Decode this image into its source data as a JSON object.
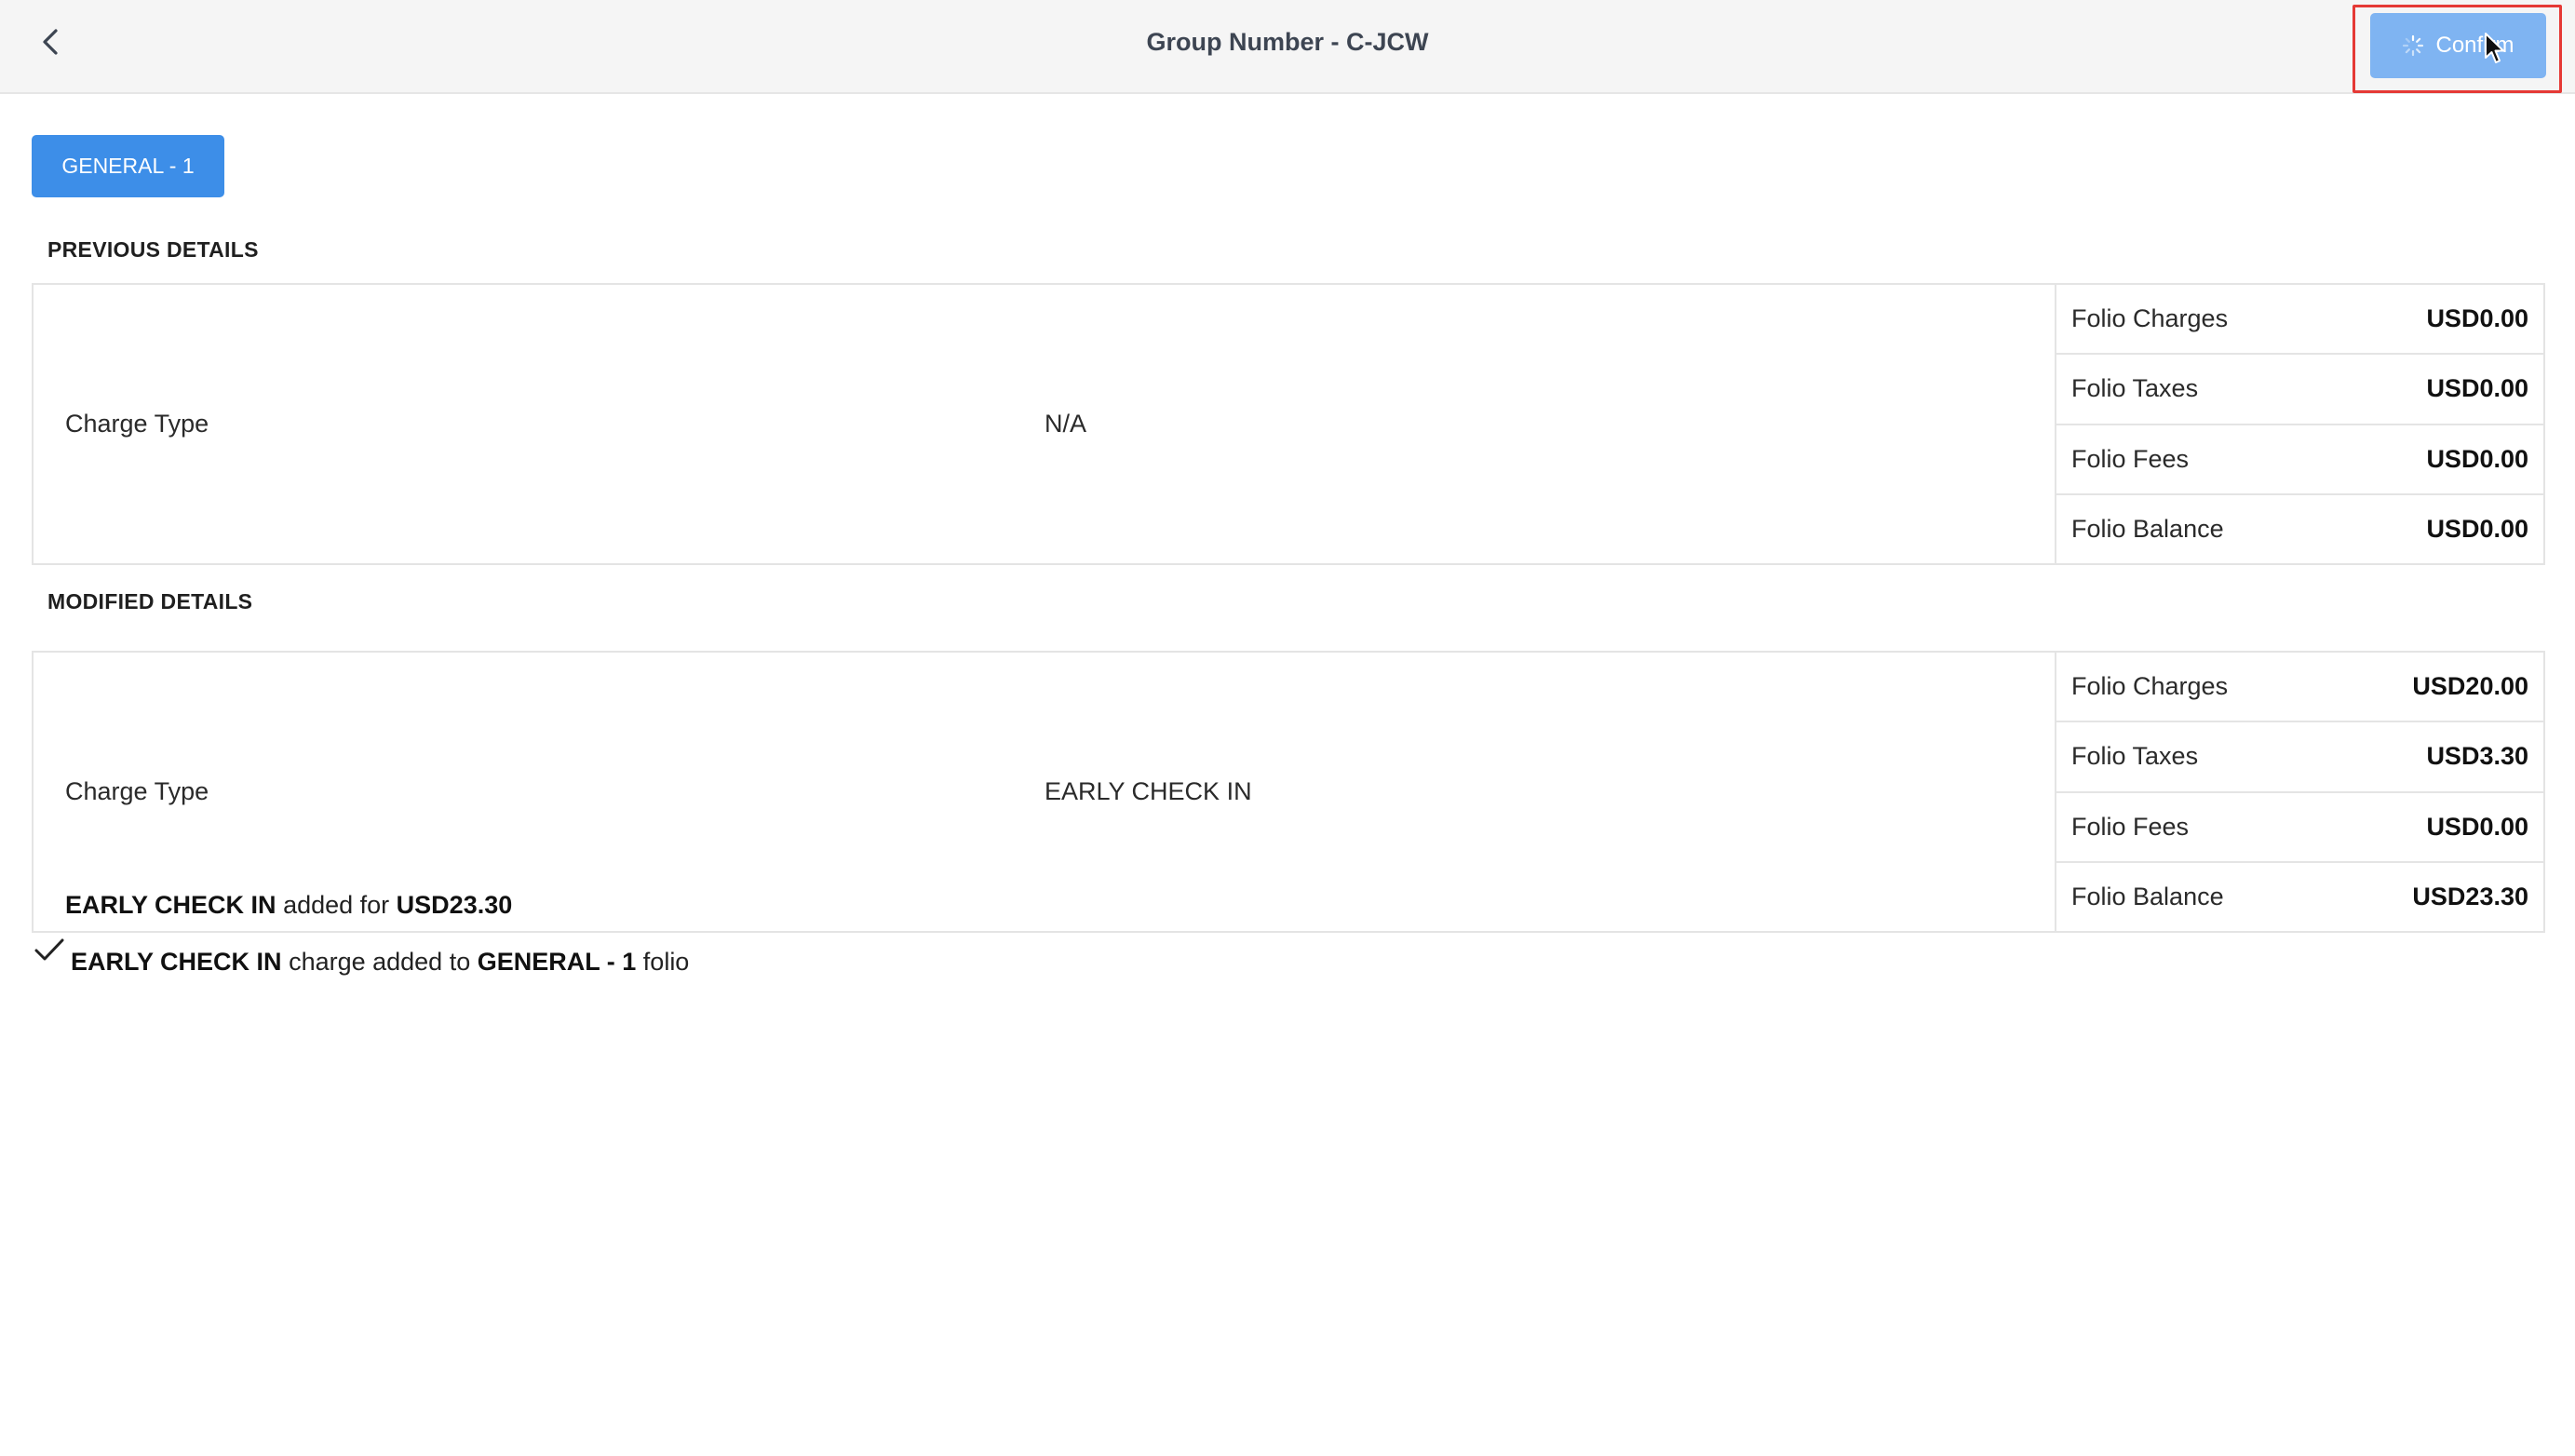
{
  "header": {
    "title": "Group Number - C-JCW",
    "confirm_label": "Confirm"
  },
  "folio_tab": {
    "label": "GENERAL - 1"
  },
  "previous": {
    "section_title": "PREVIOUS DETAILS",
    "charge_type_label": "Charge Type",
    "charge_type_value": "N/A",
    "folio": [
      {
        "name": "Folio Charges",
        "amount": "USD0.00"
      },
      {
        "name": "Folio Taxes",
        "amount": "USD0.00"
      },
      {
        "name": "Folio Fees",
        "amount": "USD0.00"
      },
      {
        "name": "Folio Balance",
        "amount": "USD0.00"
      }
    ]
  },
  "modified": {
    "section_title": "MODIFIED DETAILS",
    "charge_type_label": "Charge Type",
    "charge_type_value": "EARLY CHECK IN",
    "added_charge": "EARLY CHECK IN",
    "added_text": "added for",
    "added_amount": "USD23.30",
    "folio": [
      {
        "name": "Folio Charges",
        "amount": "USD20.00"
      },
      {
        "name": "Folio Taxes",
        "amount": "USD3.30"
      },
      {
        "name": "Folio Fees",
        "amount": "USD0.00"
      },
      {
        "name": "Folio Balance",
        "amount": "USD23.30"
      }
    ]
  },
  "confirmation": {
    "charge": "EARLY CHECK IN",
    "text_mid": "charge added to",
    "folio": "GENERAL - 1",
    "text_end": "folio"
  },
  "colors": {
    "primary": "#3d8ee8",
    "confirm_loading": "#7fb4f2",
    "highlight": "#e53935"
  }
}
